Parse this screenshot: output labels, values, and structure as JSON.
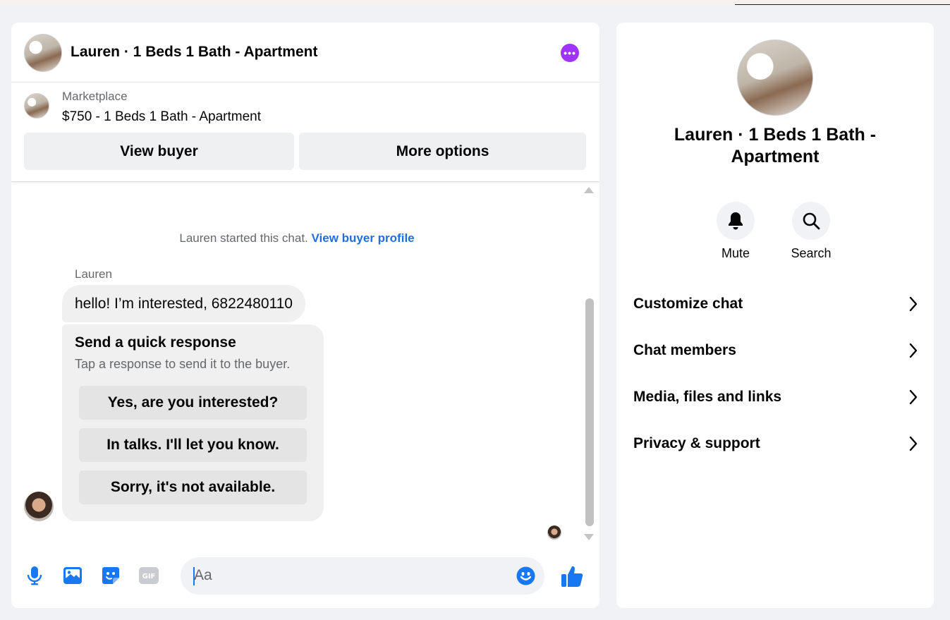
{
  "header": {
    "title": "Lauren · 1 Beds 1 Bath - Apartment",
    "more_icon": "more-horizontal-icon"
  },
  "listing": {
    "source": "Marketplace",
    "price_title": "$750 - 1 Beds 1 Bath - Apartment",
    "view_buyer_label": "View buyer",
    "more_options_label": "More options"
  },
  "conversation": {
    "started_text": "Lauren started this chat.",
    "started_link": "View buyer profile",
    "sender_name": "Lauren",
    "message": "hello! I’m interested, 6822480110",
    "quick_response": {
      "title": "Send a quick response",
      "subtitle": "Tap a response to send it to the buyer.",
      "options": [
        "Yes, are you interested?",
        "In talks. I'll let you know.",
        "Sorry, it's not available."
      ]
    }
  },
  "composer": {
    "placeholder": "Aa",
    "icons": [
      "microphone-icon",
      "photo-icon",
      "sticker-icon",
      "gif-icon",
      "emoji-icon",
      "thumbs-up-icon"
    ],
    "accent_color": "#1877f2"
  },
  "info_panel": {
    "title": "Lauren · 1 Beds 1 Bath - Apartment",
    "actions": [
      {
        "label": "Mute",
        "icon": "bell-icon"
      },
      {
        "label": "Search",
        "icon": "search-icon"
      }
    ],
    "menu": [
      "Customize chat",
      "Chat members",
      "Media, files and links",
      "Privacy & support"
    ]
  },
  "colors": {
    "link": "#216fdb",
    "more_button": "#a033ff",
    "bubble": "#f0f0f0"
  }
}
